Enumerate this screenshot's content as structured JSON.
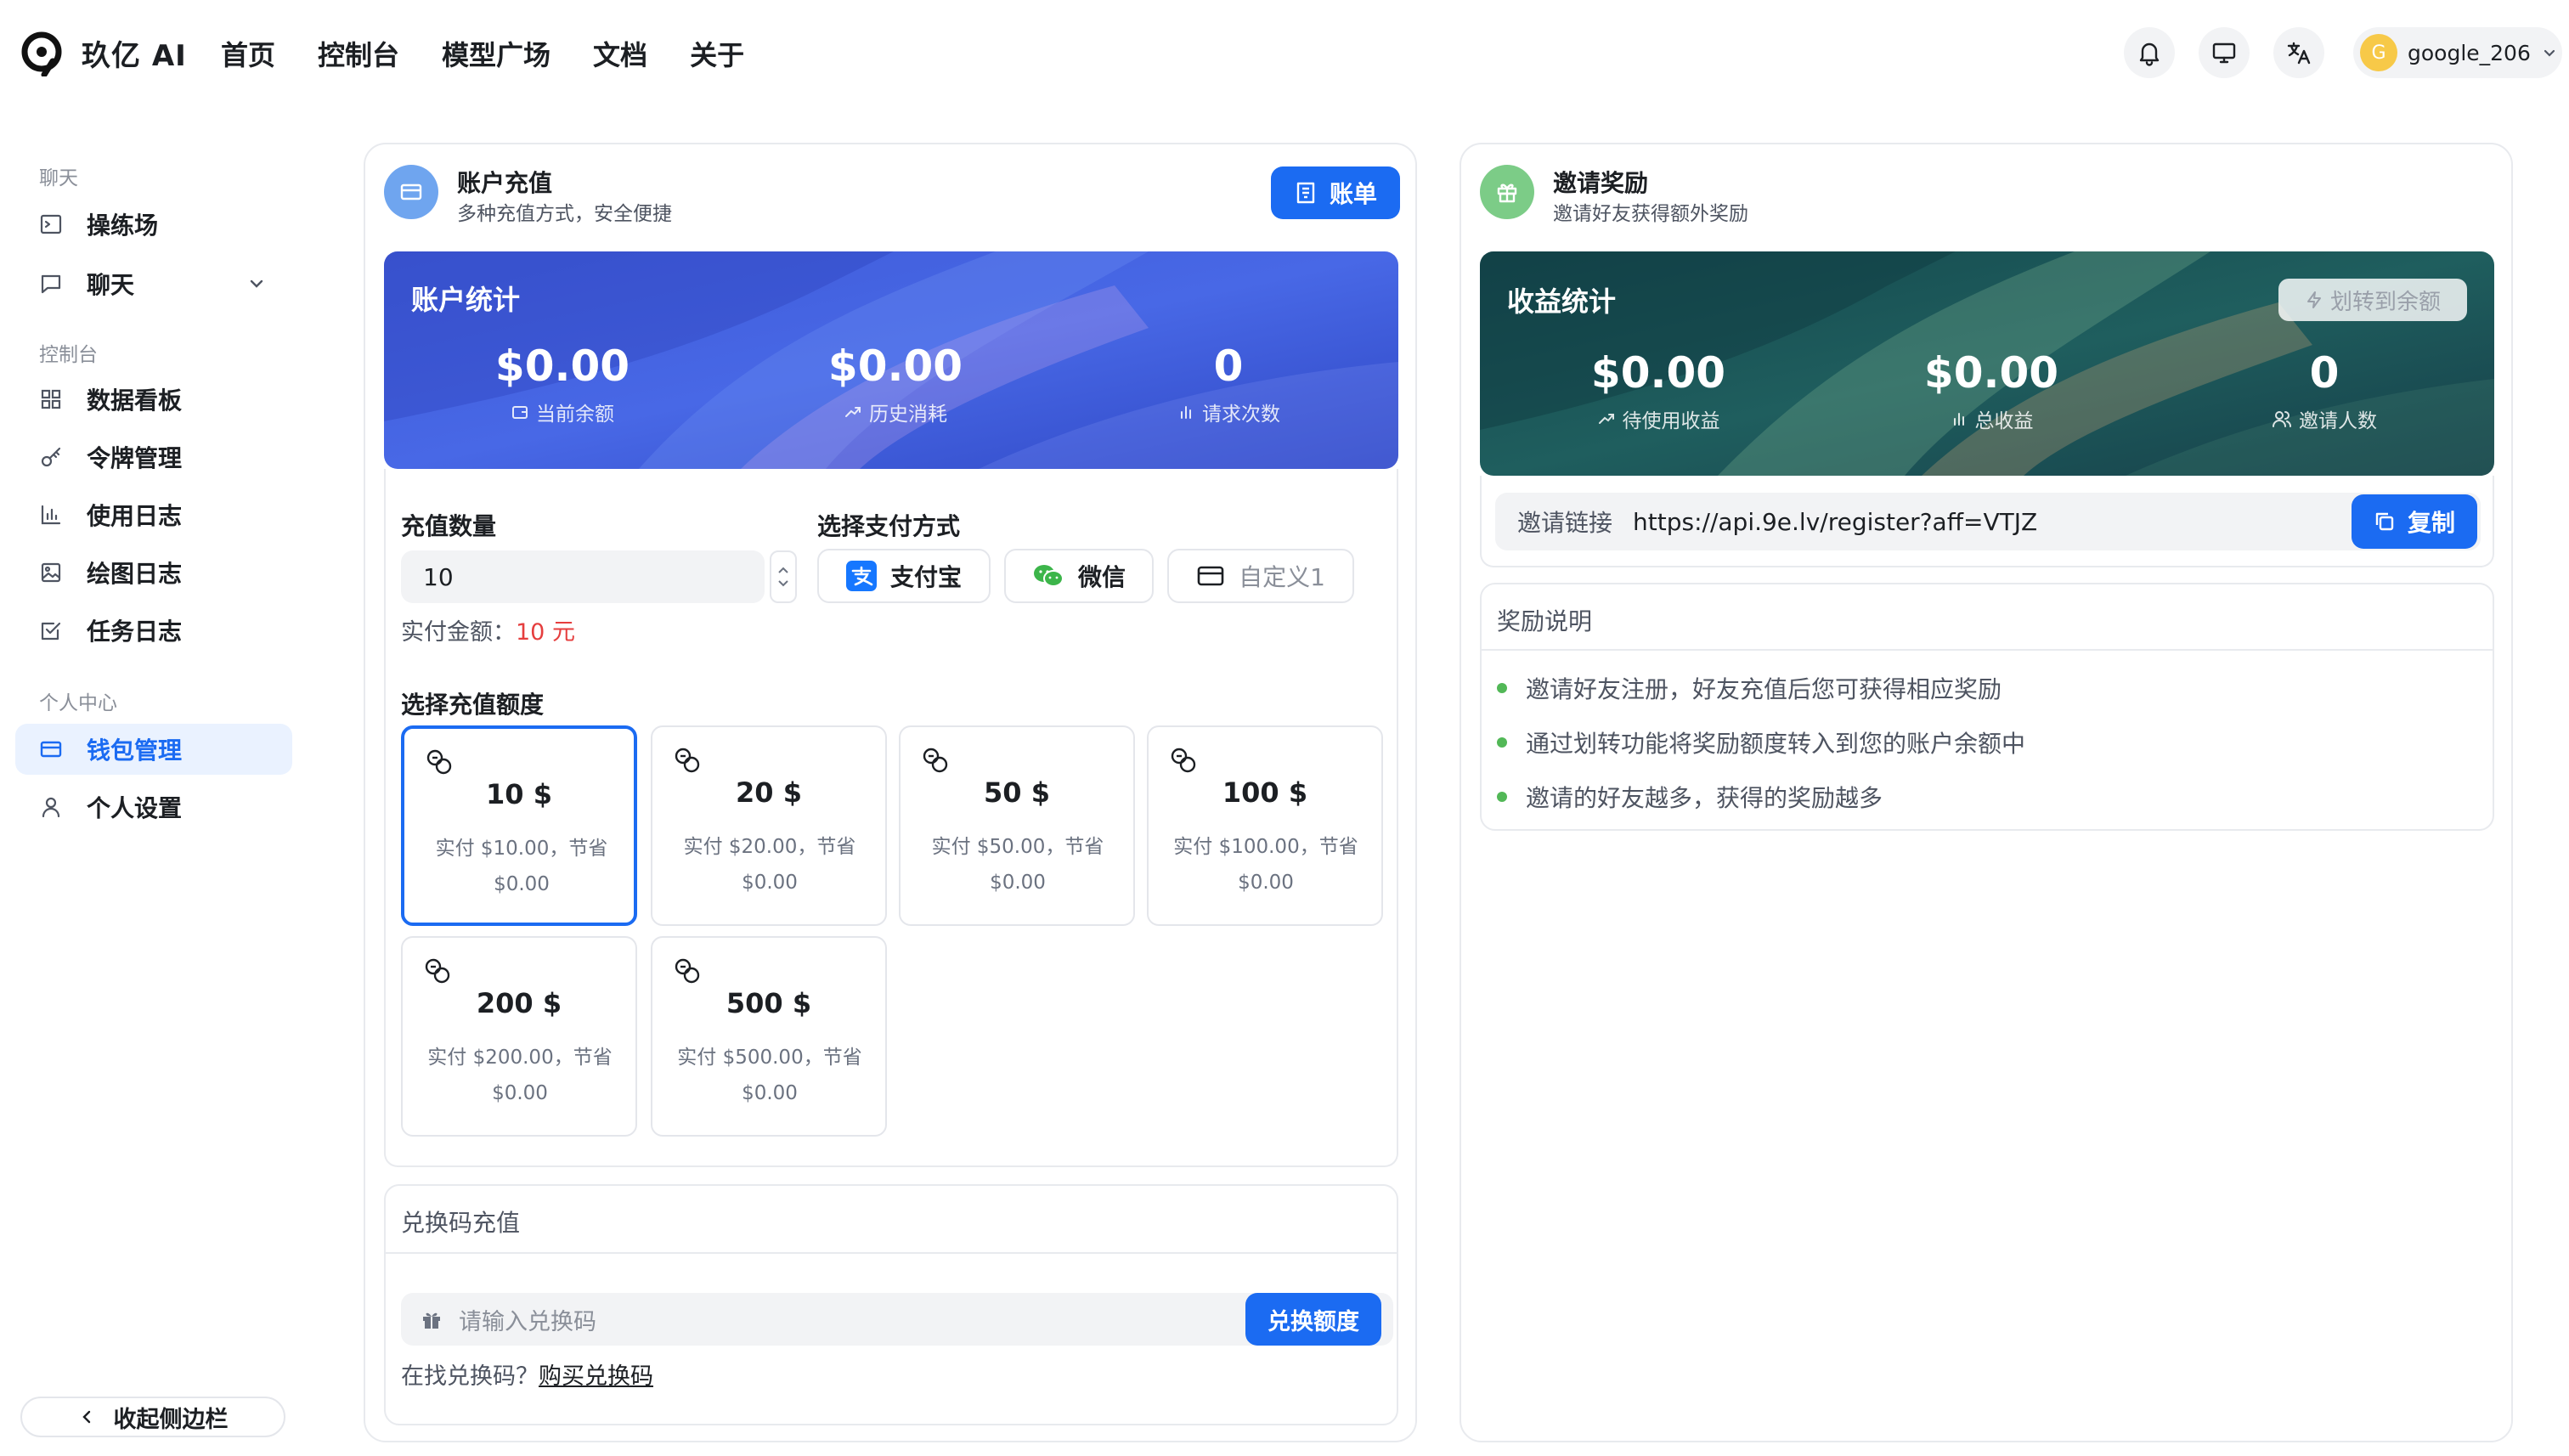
{
  "app": {
    "brand": "玖亿 AI"
  },
  "nav": {
    "items": [
      "首页",
      "控制台",
      "模型广场",
      "文档",
      "关于"
    ]
  },
  "user": {
    "avatar_letter": "G",
    "name": "google_206"
  },
  "sidebar": {
    "groups": {
      "chat": "聊天",
      "console": "控制台",
      "personal": "个人中心"
    },
    "items": {
      "playground": "操练场",
      "chat": "聊天",
      "dashboard": "数据看板",
      "tokens": "令牌管理",
      "usage": "使用日志",
      "drawing": "绘图日志",
      "tasks": "任务日志",
      "wallet": "钱包管理",
      "settings": "个人设置"
    },
    "collapse": "收起侧边栏"
  },
  "recharge": {
    "title": "账户充值",
    "subtitle": "多种充值方式，安全便捷",
    "bill_button": "账单",
    "stats_title": "账户统计",
    "stats": [
      {
        "value": "$0.00",
        "label": "当前余额"
      },
      {
        "value": "$0.00",
        "label": "历史消耗"
      },
      {
        "value": "0",
        "label": "请求次数"
      }
    ],
    "amount_label": "充值数量",
    "amount_value": "10",
    "pay_label": "选择支付方式",
    "pay_methods": [
      "支付宝",
      "微信",
      "自定义1"
    ],
    "paid_prefix": "实付金额：",
    "paid_value": "10 元",
    "quota_label": "选择充值额度",
    "quotas": [
      {
        "amount": "10 $",
        "desc1": "实付 $10.00，节省",
        "desc2": "$0.00"
      },
      {
        "amount": "20 $",
        "desc1": "实付 $20.00，节省",
        "desc2": "$0.00"
      },
      {
        "amount": "50 $",
        "desc1": "实付 $50.00，节省",
        "desc2": "$0.00"
      },
      {
        "amount": "100 $",
        "desc1": "实付 $100.00，节省",
        "desc2": "$0.00"
      },
      {
        "amount": "200 $",
        "desc1": "实付 $200.00，节省",
        "desc2": "$0.00"
      },
      {
        "amount": "500 $",
        "desc1": "实付 $500.00，节省",
        "desc2": "$0.00"
      }
    ],
    "selected_quota_index": 0
  },
  "redeem": {
    "title": "兑换码充值",
    "placeholder": "请输入兑换码",
    "button": "兑换额度",
    "hint_prefix": "在找兑换码？",
    "hint_link": "购买兑换码"
  },
  "invite": {
    "title": "邀请奖励",
    "subtitle": "邀请好友获得额外奖励",
    "stats_title": "收益统计",
    "transfer_button": "划转到余额",
    "stats": [
      {
        "value": "$0.00",
        "label": "待使用收益"
      },
      {
        "value": "$0.00",
        "label": "总收益"
      },
      {
        "value": "0",
        "label": "邀请人数"
      }
    ],
    "link_label": "邀请链接",
    "link_url": "https://api.9e.lv/register?aff=VTJZ",
    "copy_button": "复制",
    "rules_title": "奖励说明",
    "rules": [
      "邀请好友注册，好友充值后您可获得相应奖励",
      "通过划转功能将奖励额度转入到您的账户余额中",
      "邀请的好友越多，获得的奖励越多"
    ]
  },
  "colors": {
    "accent": "#1b6bf2",
    "price_red": "#e53e3e",
    "bullet_green": "#52b857"
  }
}
